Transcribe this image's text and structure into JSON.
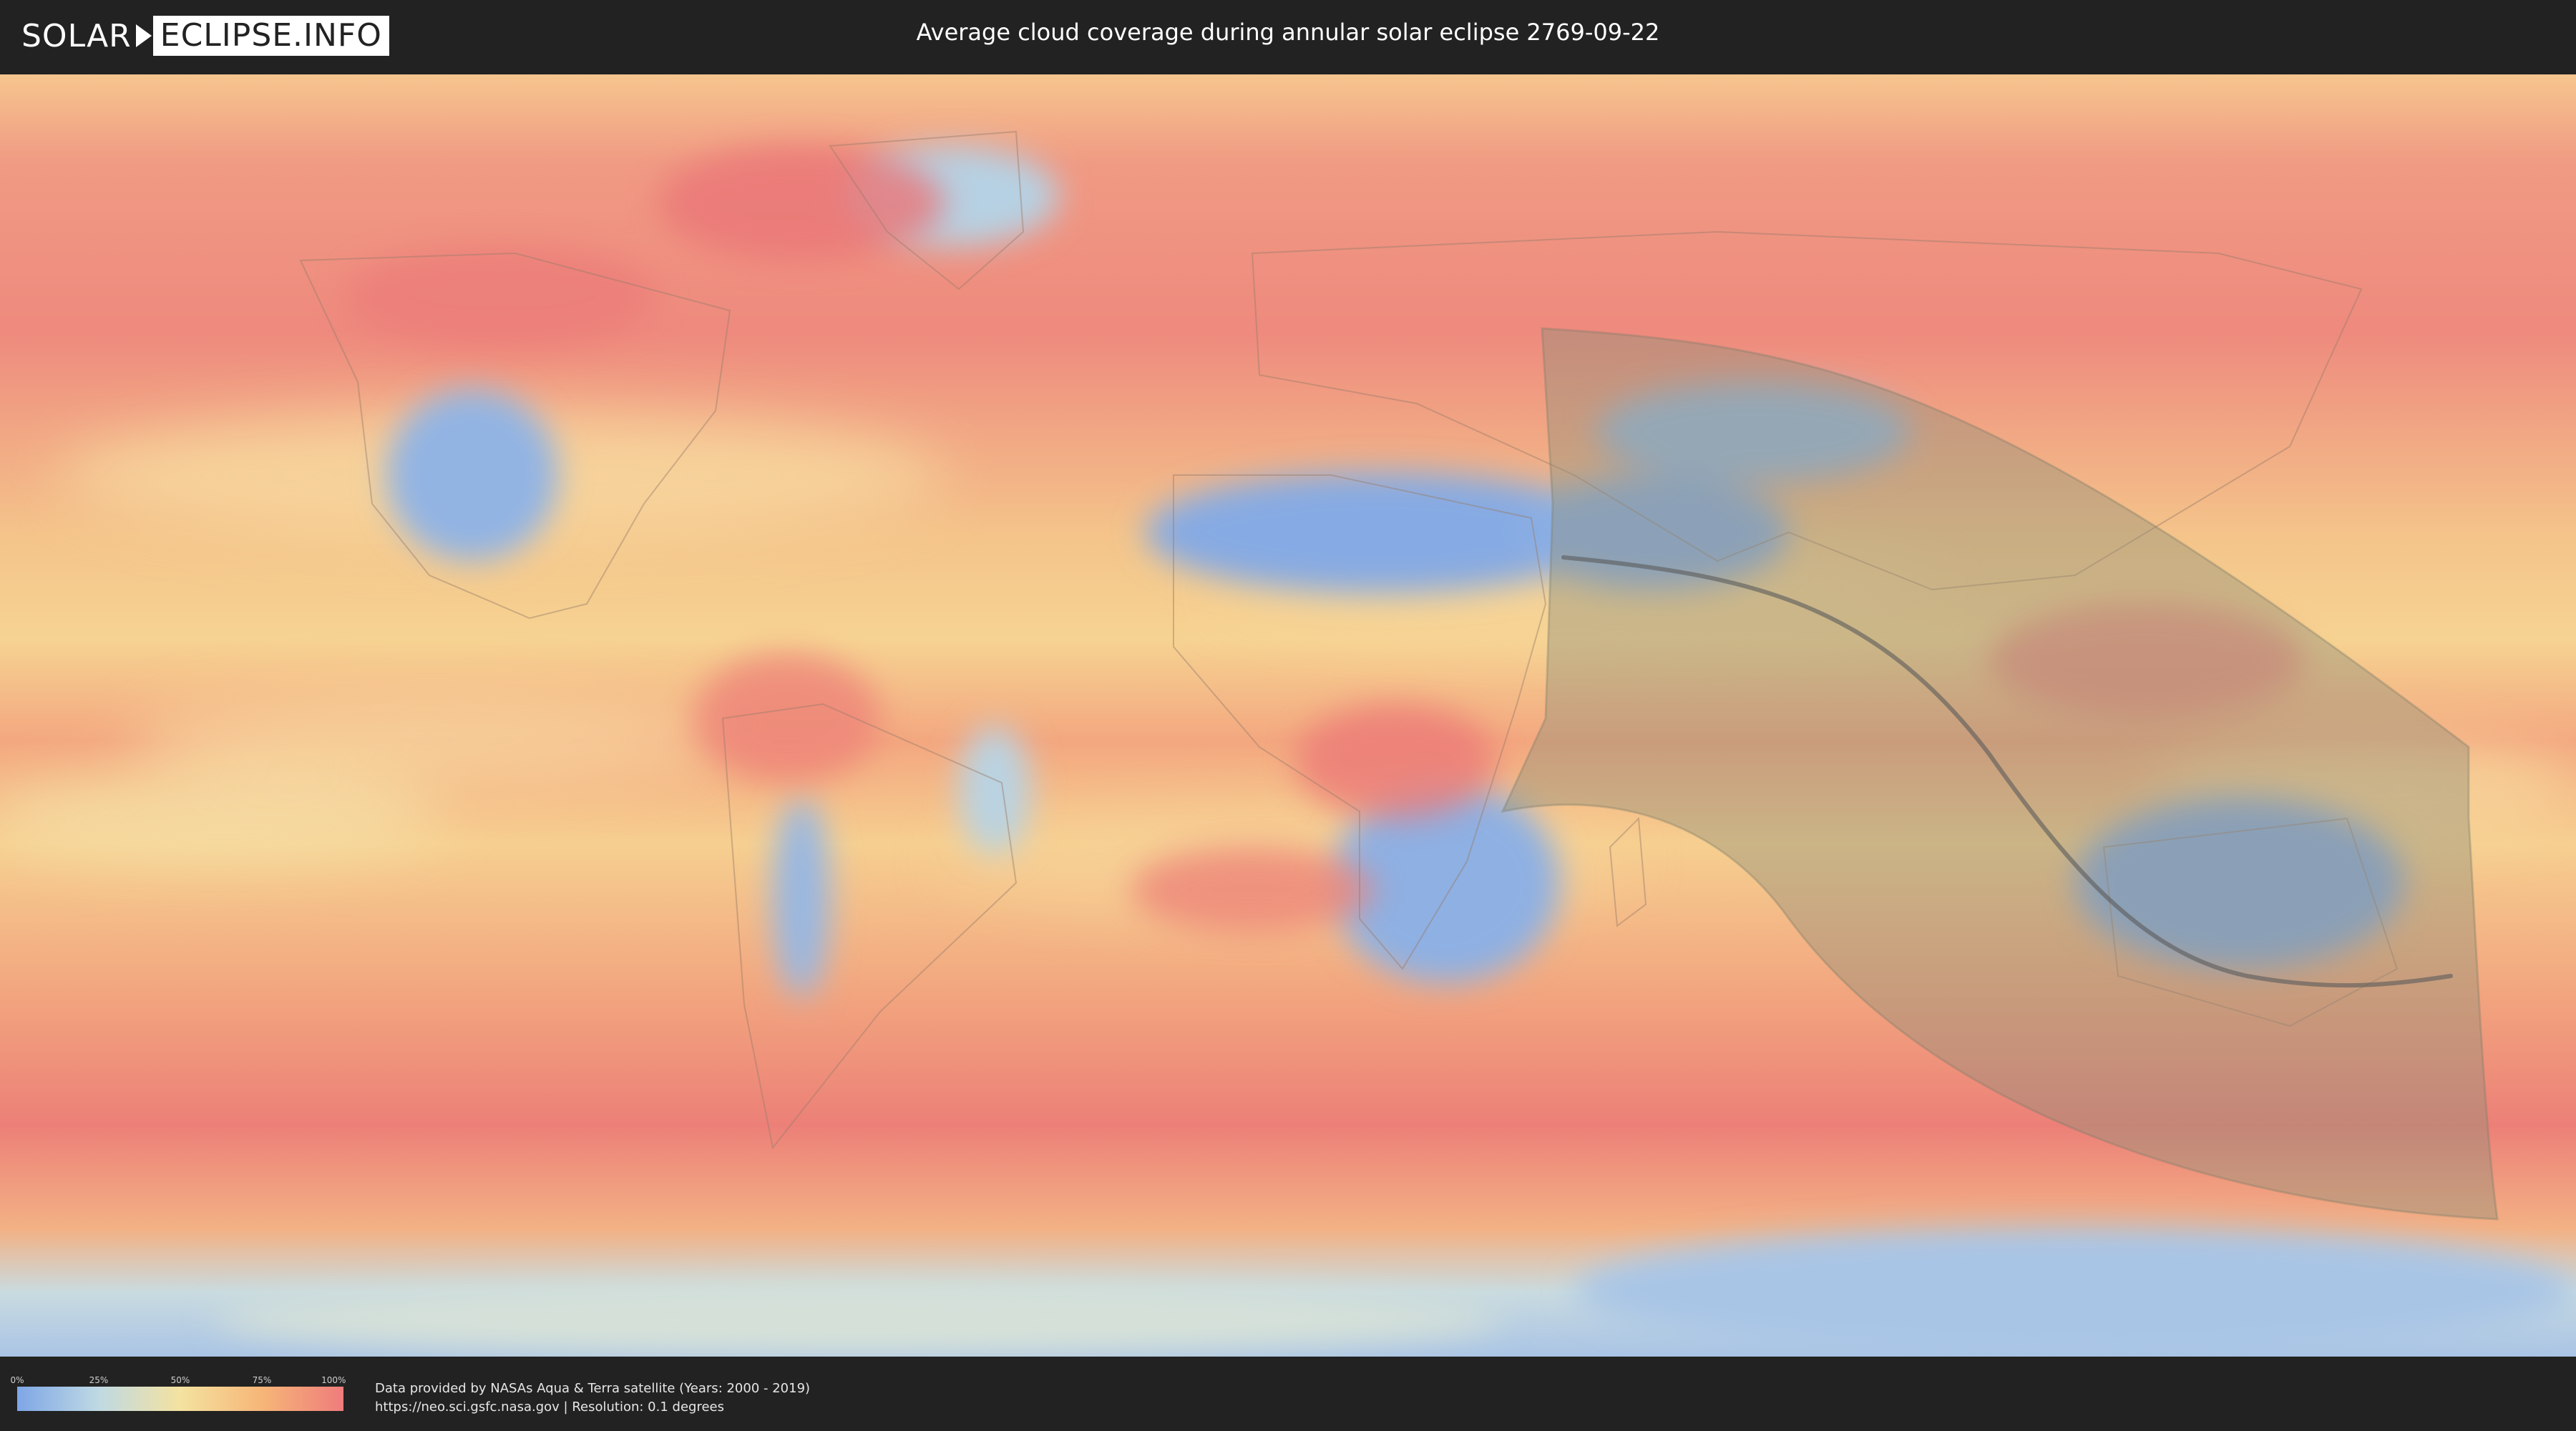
{
  "header": {
    "logo_part1": "SOLAR",
    "logo_part2": "ECLIPSE.INFO",
    "title": "Average cloud coverage during annular solar eclipse 2769-09-22"
  },
  "legend": {
    "ticks": [
      "0%",
      "25%",
      "50%",
      "75%",
      "100%"
    ],
    "tick_values": [
      0,
      0.25,
      0.5,
      0.75,
      1.0
    ],
    "colors": [
      "#7ea6e6",
      "#bfd9e3",
      "#f4e2a0",
      "#f6b678",
      "#ef7c7c"
    ]
  },
  "footer": {
    "attribution_line1": "Data provided by NASAs Aqua & Terra satellite (Years: 2000 - 2019)",
    "attribution_line2": "https://neo.sci.gsfc.nasa.gov | Resolution: 0.1 degrees"
  },
  "colors": {
    "background": "#222222",
    "ocean_cloud": "#f0a079",
    "clear_sky": "#87aee4",
    "eclipse_zone": "#8f8f7a",
    "central_line": "#5a5a5a"
  }
}
